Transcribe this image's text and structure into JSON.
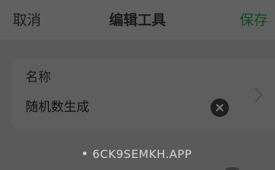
{
  "nav": {
    "cancel_label": "取消",
    "title": "编辑工具",
    "save_label": "保存",
    "save_color": "#0d4a1f"
  },
  "form": {
    "name_label": "名称",
    "name_value": "随机数生成",
    "clear_icon": "clear-circle-icon",
    "disclosure_icon": "chevron-right-icon"
  },
  "watermark": {
    "text": "6CK9SEMKH.APP"
  }
}
